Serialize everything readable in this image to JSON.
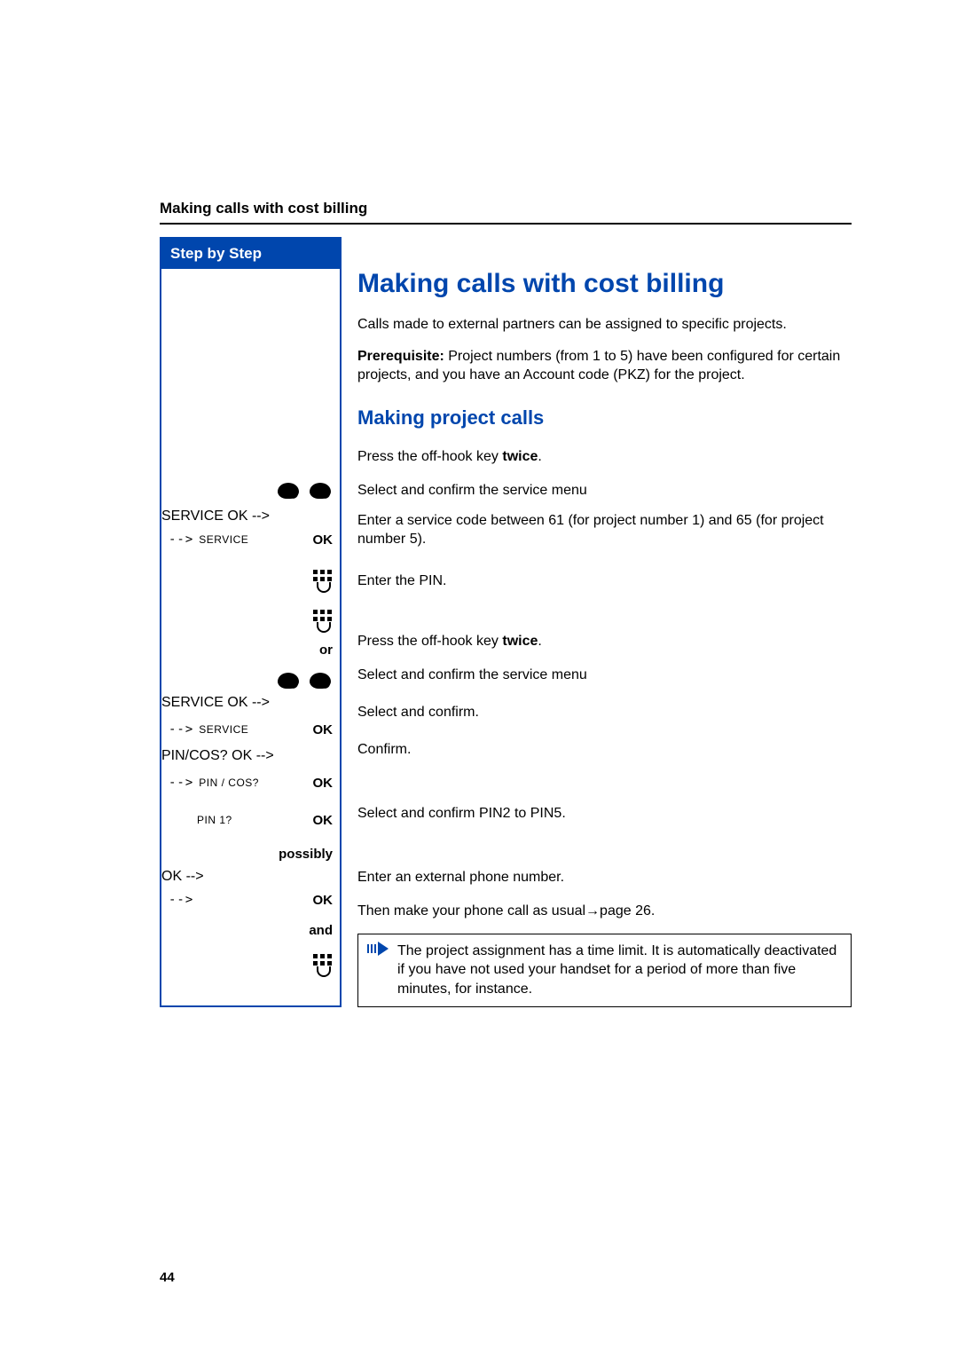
{
  "header": "Making calls with cost billing",
  "sidebar_title": "Step by Step",
  "title": "Making calls with cost billing",
  "intro": "Calls made to external partners can be assigned to specific projects.",
  "prerequisite_label": "Prerequisite:",
  "prerequisite_text": " Project numbers (from 1 to 5) have been configured for certain projects, and you have an Account code (PKZ) for the project.",
  "section_title": "Making project calls",
  "labels": {
    "service": "SERVICE",
    "pincos": "PIN / COS?",
    "pin1": "PIN 1?",
    "ok": "OK",
    "or": "or",
    "possibly": "possibly",
    "and": "and",
    "arrow": "-->"
  },
  "steps": {
    "s1a": "Press the off-hook key ",
    "s1b": "twice",
    "s1c": ".",
    "s2": "Select and confirm the service menu",
    "s3": "Enter a service code between 61 (for project number 1) and 65 (for project number 5).",
    "s4": "Enter the PIN.",
    "s5a": "Press the off-hook key ",
    "s5b": "twice",
    "s5c": ".",
    "s6": "Select and confirm the service menu",
    "s7": "Select and confirm.",
    "s8": "Confirm.",
    "s9": "Select and confirm PIN2 to PIN5.",
    "s10": "Enter an external phone number.",
    "s11a": "Then make your phone call as usual ",
    "s11arrow": "→",
    "s11b": " page 26."
  },
  "note": "The project assignment has a time limit. It is automatically deactivated if you have not used your handset for a period of more than five minutes, for instance.",
  "page_number": "44"
}
